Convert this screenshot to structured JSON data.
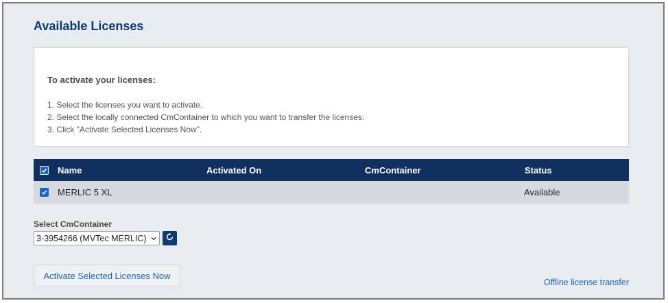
{
  "page": {
    "title": "Available Licenses"
  },
  "instructions": {
    "heading": "To activate your licenses:",
    "steps": [
      "1. Select the licenses you want to activate.",
      "2. Select the locally connected CmContainer to which you want to transfer the licenses.",
      "3. Click \"Activate Selected Licenses Now\"."
    ]
  },
  "table": {
    "columns": [
      "Name",
      "Activated On",
      "CmContainer",
      "Status"
    ],
    "rows": [
      {
        "checked": true,
        "name": "MERLIC 5 XL",
        "activated_on": "",
        "cmcontainer": "",
        "status": "Available"
      }
    ]
  },
  "container_select": {
    "label": "Select CmContainer",
    "selected": "3-3954266 (MVTec MERLIC)"
  },
  "actions": {
    "activate_label": "Activate Selected Licenses Now",
    "offline_link": "Offline license transfer"
  },
  "colors": {
    "title": "#0e3a71",
    "header_bg": "#10305f",
    "row_bg": "#d6dae0",
    "link": "#1e63c0",
    "checkbox": "#1c63c7"
  },
  "icons": {
    "checkbox": "checkmark-icon",
    "dropdown": "chevron-down-icon",
    "refresh": "refresh-icon"
  }
}
